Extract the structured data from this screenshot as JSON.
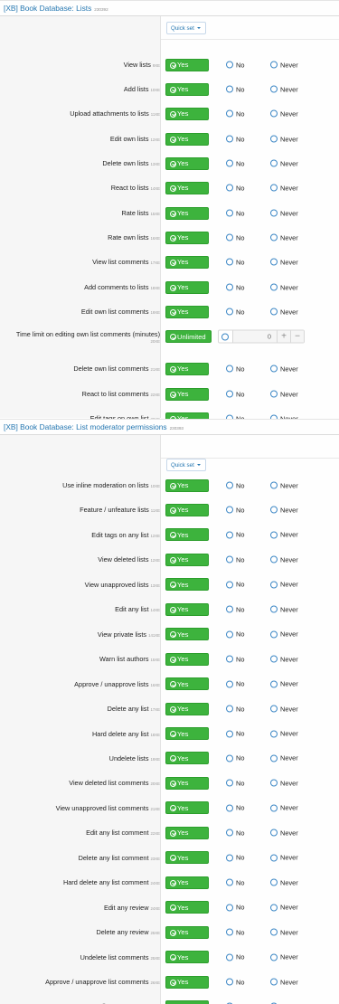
{
  "options": {
    "yes": "Yes",
    "no": "No",
    "never": "Never",
    "unlimited": "Unlimited"
  },
  "quick_set": "Quick set",
  "section1": {
    "title": "[XB] Book Database: Lists",
    "id": "230392",
    "rows": [
      {
        "label": "View lists",
        "pid": "9XE"
      },
      {
        "label": "Add lists",
        "pid": "10XE"
      },
      {
        "label": "Upload attachments to lists",
        "pid": "11XE"
      },
      {
        "label": "Edit own lists",
        "pid": "12XE"
      },
      {
        "label": "Delete own lists",
        "pid": "13XE"
      },
      {
        "label": "React to lists",
        "pid": "14XE"
      },
      {
        "label": "Rate lists",
        "pid": "15XE"
      },
      {
        "label": "Rate own lists",
        "pid": "16XE"
      },
      {
        "label": "View list comments",
        "pid": "17XE"
      },
      {
        "label": "Add comments to lists",
        "pid": "18XE"
      },
      {
        "label": "Edit own list comments",
        "pid": "19XE"
      }
    ],
    "time_limit": {
      "label": "Time limit on editing own list comments (minutes)",
      "pid": "20XE",
      "value": "0",
      "plus": "+",
      "minus": "−"
    },
    "rows2": [
      {
        "label": "Delete own list comments",
        "pid": "21XE"
      },
      {
        "label": "React to list comments",
        "pid": "22XE"
      },
      {
        "label": "Edit tags on own list",
        "pid": "30XE"
      }
    ]
  },
  "section2": {
    "title": "[XB] Book Database: List moderator permissions",
    "id": "230393",
    "rows": [
      {
        "label": "Use inline moderation on lists",
        "pid": "10XE"
      },
      {
        "label": "Feature / unfeature lists",
        "pid": "11XE"
      },
      {
        "label": "Edit tags on any list",
        "pid": "12XE"
      },
      {
        "label": "View deleted lists",
        "pid": "12XE"
      },
      {
        "label": "View unapproved lists",
        "pid": "13XE"
      },
      {
        "label": "Edit any list",
        "pid": "14XE"
      },
      {
        "label": "View private lists",
        "pid": "141XE"
      },
      {
        "label": "Warn list authors",
        "pid": "15XE"
      },
      {
        "label": "Approve / unapprove lists",
        "pid": "16XE"
      },
      {
        "label": "Delete any list",
        "pid": "17XE"
      },
      {
        "label": "Hard delete any list",
        "pid": "18XE"
      },
      {
        "label": "Undelete lists",
        "pid": "19XE"
      },
      {
        "label": "View deleted list comments",
        "pid": "20XE"
      },
      {
        "label": "View unapproved list comments",
        "pid": "21XE"
      },
      {
        "label": "Edit any list comment",
        "pid": "22XE"
      },
      {
        "label": "Delete any list comment",
        "pid": "23XE"
      },
      {
        "label": "Hard delete any list comment",
        "pid": "24XE"
      },
      {
        "label": "Edit any review",
        "pid": "24XE"
      },
      {
        "label": "Delete any review",
        "pid": "25XE"
      },
      {
        "label": "Undelete list comments",
        "pid": "25XE"
      },
      {
        "label": "Approve / unapprove list comments",
        "pid": "26XE"
      },
      {
        "label": "Warn list commenters",
        "pid": "27XE"
      }
    ]
  },
  "colors": {
    "accent": "#2577b1",
    "yes_green": "#3db33d",
    "radio_blue": "#3d87c5"
  }
}
